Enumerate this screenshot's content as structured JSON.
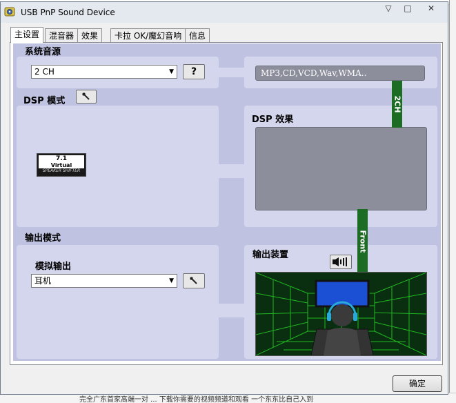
{
  "window": {
    "title": "USB PnP Sound Device",
    "controls": [
      "▽",
      "□",
      "✕"
    ]
  },
  "tabs": [
    {
      "label": "主设置",
      "active": true
    },
    {
      "label": "混音器",
      "active": false
    },
    {
      "label": "效果",
      "active": false
    },
    {
      "label": "卡拉 OK/魔幻音响",
      "active": false
    },
    {
      "label": "信息",
      "active": false
    }
  ],
  "system_source": {
    "heading": "系统音源",
    "selected": "2 CH",
    "help_label": "?",
    "formats": "MP3,CD,VCD,Wav,WMA.."
  },
  "dsp_mode": {
    "heading": "DSP 模式",
    "logo": {
      "line1": "7.1",
      "line2": "Virtual",
      "line3": "SPEAKER SHIFTER"
    }
  },
  "dsp_effect": {
    "heading": "DSP 效果"
  },
  "connectors": {
    "top": "2CH",
    "bottom": "Front"
  },
  "output_mode": {
    "heading": "输出模式",
    "sub_heading": "模拟输出",
    "selected": "耳机"
  },
  "output_device": {
    "heading": "输出装置"
  },
  "footer": {
    "ok_label": "确定"
  },
  "background": {
    "bottom_text": "完全广东首家高端一对 ...     下载你需要的视频频道和观看   一个东东比自己入到"
  },
  "colors": {
    "panel": "#bfc2e0",
    "card": "#d4d6ee",
    "connector": "#1c6c24",
    "grid": "#25d125"
  },
  "icons": [
    "wrench-icon",
    "speaker-icon",
    "headphone-scene",
    "chevron-down-icon"
  ]
}
